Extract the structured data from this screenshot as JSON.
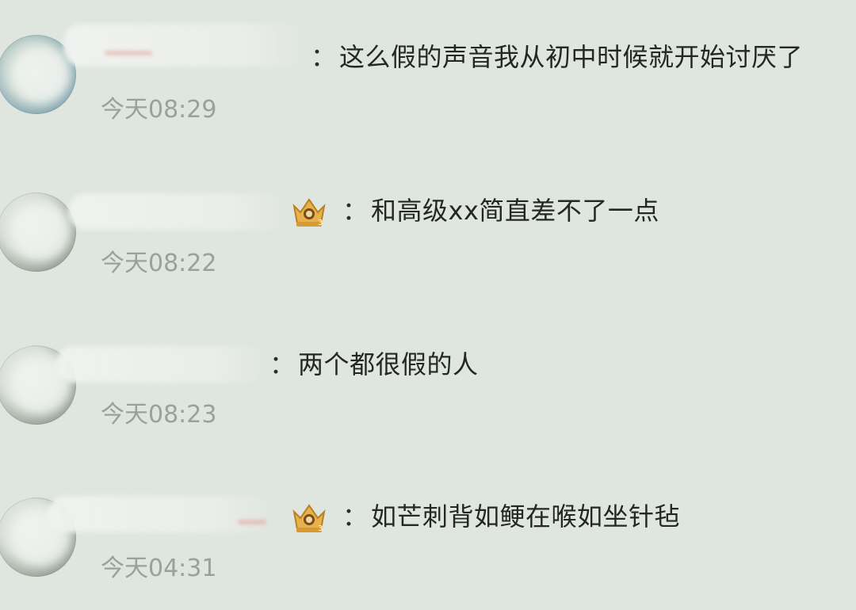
{
  "comments": [
    {
      "text": "这么假的声音我从初中时候就开始讨厌了",
      "time": "今天08:29",
      "has_badge": false
    },
    {
      "text": "和高级xx简直差不了一点",
      "time": "今天08:22",
      "has_badge": true
    },
    {
      "text": "两个都很假的人",
      "time": "今天08:23",
      "has_badge": false
    },
    {
      "text": "如芒刺背如鲠在喉如坐针毡",
      "time": "今天04:31",
      "has_badge": true
    }
  ],
  "separator": "：",
  "colors": {
    "background": "#dfe6df",
    "text": "#262626",
    "time": "#9aa19a",
    "badge_gold": "#e2a93a"
  },
  "icons": {
    "badge": "crown-badge-icon",
    "avatar": "user-avatar"
  }
}
